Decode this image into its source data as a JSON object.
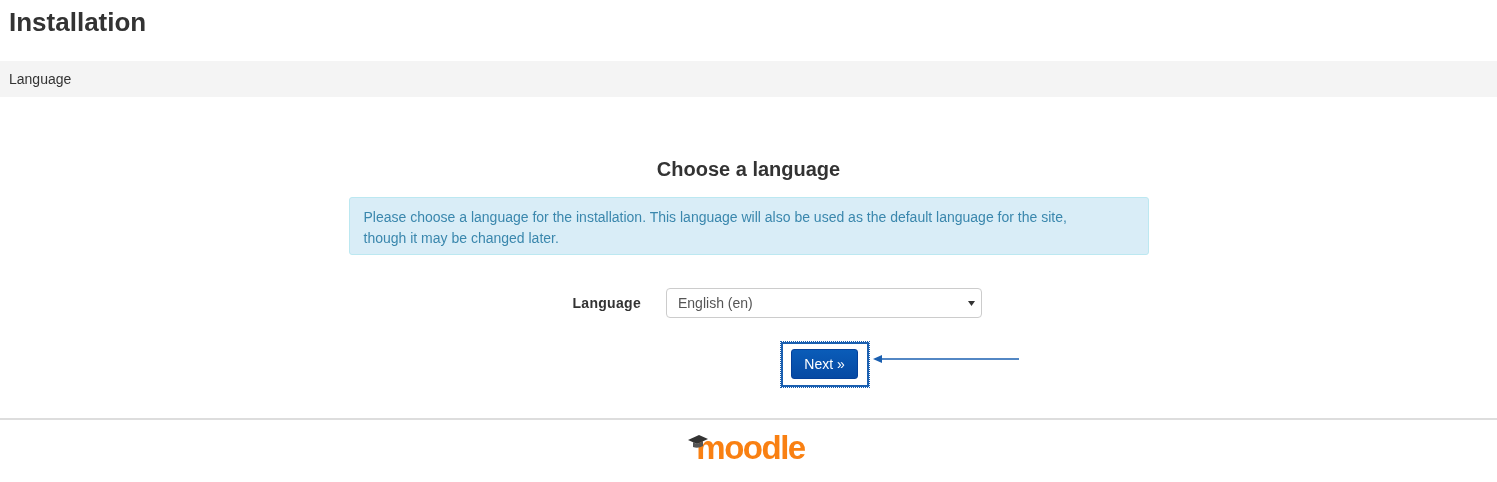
{
  "page": {
    "title": "Installation"
  },
  "breadcrumb": [
    "Language"
  ],
  "heading": "Choose a language",
  "alert": "Please choose a language for the installation. This language will also be used as the default language for the site, though it may be changed later.",
  "form": {
    "label": "Language",
    "select": {
      "value": "English (en)"
    }
  },
  "buttons": [
    {
      "label": "Next »"
    }
  ],
  "footer": {
    "logo": "moodle"
  }
}
